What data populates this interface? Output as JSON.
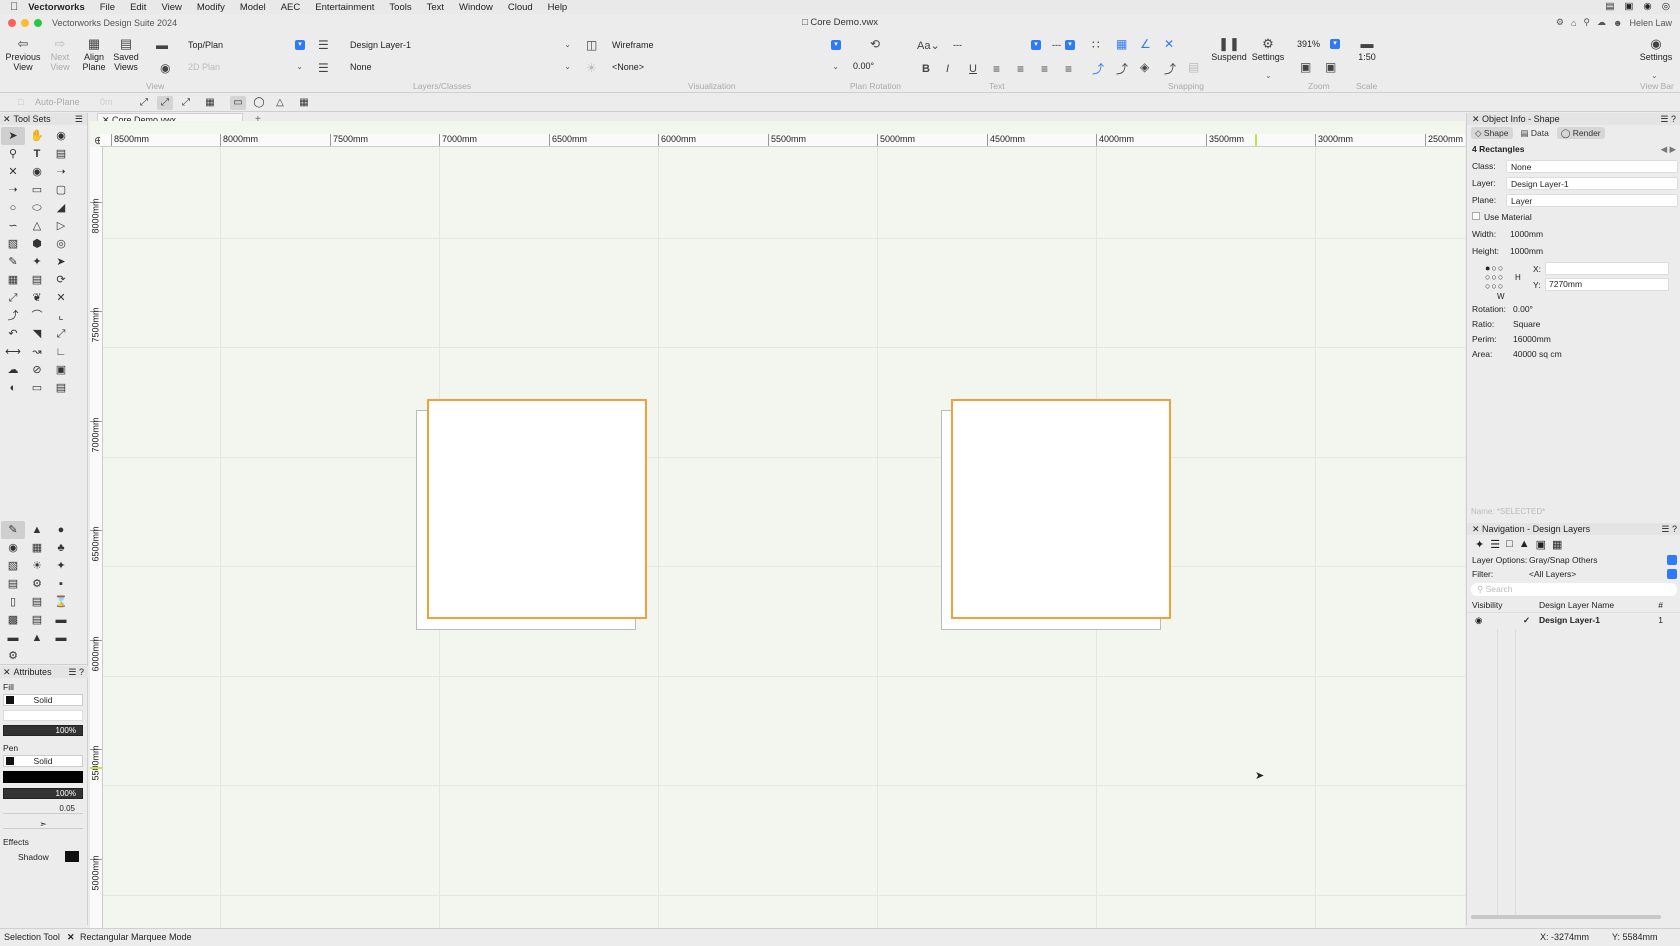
{
  "menubar": {
    "app_name": "Vectorworks",
    "items": [
      "File",
      "Edit",
      "View",
      "Modify",
      "Model",
      "AEC",
      "Entertainment",
      "Tools",
      "Text",
      "Window",
      "Cloud",
      "Help"
    ]
  },
  "window": {
    "app_title": "Vectorworks Design Suite 2024",
    "doc_title": "Core Demo.vwx",
    "user": "Helen Law"
  },
  "toolbar": {
    "previous_view": "Previous View",
    "next_view": "Next View",
    "align_plane": "Align Plane",
    "saved_views": "Saved Views",
    "view_dropdown": "Top/Plan",
    "plan_dropdown": "2D Plan",
    "layer_dropdown": "Design Layer-1",
    "class_dropdown": "None",
    "render_dropdown": "Wireframe",
    "light_dropdown": "<None>",
    "plan_rotation": "0.00°",
    "font_dash": "---",
    "size_dash": "---",
    "zoom": "391%",
    "scale": "1:50",
    "suspend": "Suspend",
    "settings": "Settings",
    "settings_right": "Settings",
    "auto_plane": "Auto-Plane",
    "auto_plane_val": "0m",
    "group_labels": {
      "view": "View",
      "layers_classes": "Layers/Classes",
      "visualization": "Visualization",
      "plan_rotation": "Plan Rotation",
      "text": "Text",
      "snapping": "Snapping",
      "zoom": "Zoom",
      "scale": "Scale",
      "view_bar": "View Bar"
    }
  },
  "left_panel": {
    "title": "Tool Sets",
    "attributes_title": "Attributes",
    "fill_label": "Fill",
    "fill_style": "Solid",
    "fill_opacity": "100%",
    "pen_label": "Pen",
    "pen_style": "Solid",
    "pen_opacity": "100%",
    "line_weight": "0.05",
    "effects_label": "Effects",
    "shadow_label": "Shadow"
  },
  "document": {
    "tab_name": "Core Demo.vwx"
  },
  "rulers": {
    "horizontal": [
      "8500mm",
      "8000mm",
      "7500mm",
      "7000mm",
      "6500mm",
      "6000mm",
      "5500mm",
      "5000mm",
      "4500mm",
      "4000mm",
      "3500mm",
      "3000mm",
      "2500mm"
    ],
    "vertical": [
      "8000mm",
      "7500mm",
      "7000mm",
      "6500mm",
      "6000mm",
      "5500mm",
      "5000mm"
    ]
  },
  "object_info": {
    "title": "Object Info - Shape",
    "tabs": [
      "Shape",
      "Data",
      "Render"
    ],
    "selection_count": "4 Rectangles",
    "class_label": "Class:",
    "class_value": "None",
    "layer_label": "Layer:",
    "layer_value": "Design Layer-1",
    "plane_label": "Plane:",
    "plane_value": "Layer",
    "use_material": "Use Material",
    "width_label": "Width:",
    "width_value": "1000mm",
    "height_label": "Height:",
    "height_value": "1000mm",
    "x_label": "X:",
    "x_value": "",
    "y_label": "Y:",
    "y_value": "7270mm",
    "h_label": "H",
    "w_label": "W",
    "rotation_label": "Rotation:",
    "rotation_value": "0.00°",
    "ratio_label": "Ratio:",
    "ratio_value": "Square",
    "perim_label": "Perim:",
    "perim_value": "16000mm",
    "area_label": "Area:",
    "area_value": "40000 sq cm",
    "name_placeholder": "Name: *SELECTED*"
  },
  "navigation": {
    "title": "Navigation - Design Layers",
    "layer_options_label": "Layer Options:",
    "layer_options_value": "Gray/Snap Others",
    "filter_label": "Filter:",
    "filter_value": "<All Layers>",
    "search_placeholder": "Search",
    "col_visibility": "Visibility",
    "col_name": "Design Layer Name",
    "col_num": "#",
    "rows": [
      {
        "name": "Design Layer-1",
        "num": "1"
      }
    ]
  },
  "status": {
    "tool": "Selection Tool",
    "mode": "Rectangular Marquee Mode",
    "x": "X: -3274mm",
    "y": "Y: 5584mm"
  },
  "colors": {
    "selection_orange": "#f0a13c",
    "canvas_bg": "#f2f6ee",
    "accent_blue": "#2f7bf5"
  }
}
